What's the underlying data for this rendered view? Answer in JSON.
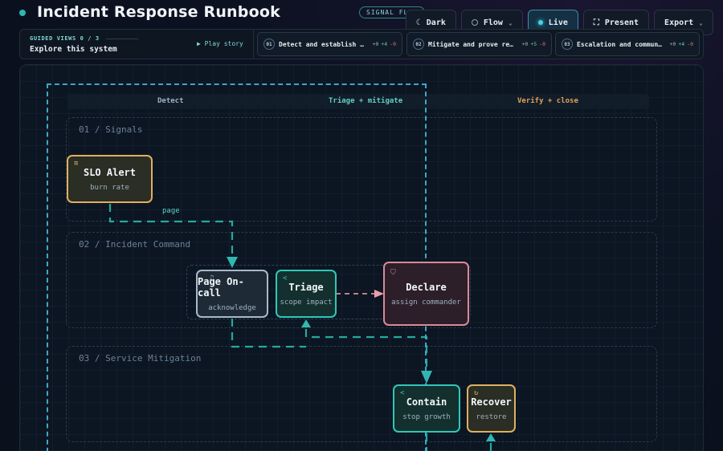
{
  "header": {
    "title": "Incident Response Runbook",
    "badge": "SIGNAL FLOW"
  },
  "toolbar": {
    "dark": "Dark",
    "flow": "Flow",
    "live": "Live",
    "present": "Present",
    "export": "Export"
  },
  "guided": {
    "label": "GUIDED VIEWS 0 / 3",
    "explore": "Explore this system",
    "play": "▶ Play story",
    "steps": [
      {
        "num": "01",
        "text": "Detect and establish comm…",
        "d0": "+0",
        "dp": "+4",
        "dm": "-0"
      },
      {
        "num": "02",
        "text": "Mitigate and prove recove…",
        "d0": "+0",
        "dp": "+5",
        "dm": "-0"
      },
      {
        "num": "03",
        "text": "Escalation and communicat…",
        "d0": "+0",
        "dp": "+4",
        "dm": "-0"
      }
    ]
  },
  "columns": {
    "detect": "Detect",
    "triage": "Triage + mitigate",
    "verify": "Verify + close"
  },
  "lanes": {
    "signals": "01 / Signals",
    "command": "02 / Incident Command",
    "mitigation": "03 / Service Mitigation"
  },
  "nodes": {
    "slo": {
      "title": "SLO Alert",
      "sub": "burn rate"
    },
    "page": {
      "title": "Page On-call",
      "sub": "acknowledge"
    },
    "triage": {
      "title": "Triage",
      "sub": "scope impact"
    },
    "declare": {
      "title": "Declare",
      "sub": "assign commander"
    },
    "contain": {
      "title": "Contain",
      "sub": "stop growth"
    },
    "recover": {
      "title": "Recover",
      "sub": "restore"
    }
  },
  "edges": {
    "page_label": "page"
  },
  "colors": {
    "teal": "#2fb8b0",
    "amber": "#e0b060",
    "rose": "#d98a96",
    "slate": "#a9bac8"
  }
}
